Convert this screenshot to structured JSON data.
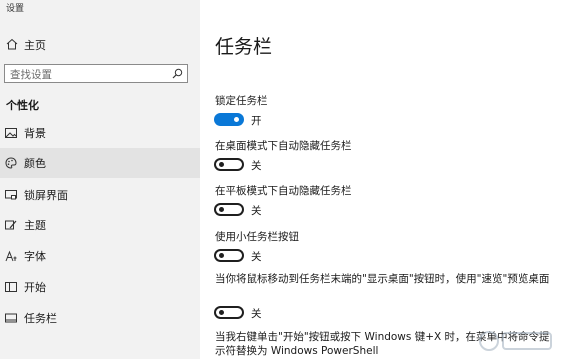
{
  "window": {
    "title": "设置"
  },
  "sidebar": {
    "home_label": "主页",
    "search_placeholder": "查找设置",
    "section_title": "个性化",
    "items": [
      {
        "label": "背景",
        "icon": "picture-icon",
        "selected": false
      },
      {
        "label": "颜色",
        "icon": "palette-icon",
        "selected": true
      },
      {
        "label": "锁屏界面",
        "icon": "lock-screen-icon",
        "selected": false
      },
      {
        "label": "主题",
        "icon": "brush-icon",
        "selected": false
      },
      {
        "label": "字体",
        "icon": "font-icon",
        "selected": false
      },
      {
        "label": "开始",
        "icon": "start-icon",
        "selected": false
      },
      {
        "label": "任务栏",
        "icon": "taskbar-icon",
        "selected": false
      }
    ]
  },
  "main": {
    "title": "任务栏",
    "settings": [
      {
        "label": "锁定任务栏",
        "state": "开",
        "on": true
      },
      {
        "label": "在桌面模式下自动隐藏任务栏",
        "state": "关",
        "on": false
      },
      {
        "label": "在平板模式下自动隐藏任务栏",
        "state": "关",
        "on": false
      },
      {
        "label": "使用小任务栏按钮",
        "state": "关",
        "on": false
      },
      {
        "label": "当你将鼠标移动到任务栏末端的\"显示桌面\"按钮时，使用\"速览\"预览桌面",
        "state": "关",
        "on": false
      },
      {
        "label": "当我右键单击\"开始\"按钮或按下 Windows 键+X 时，在菜单中将命令提示符替换为 Windows PowerShell"
      }
    ]
  },
  "colors": {
    "accent": "#0a78d7",
    "sidebar_bg": "#f2f2f2",
    "selected_bg": "#e3e3e3"
  }
}
